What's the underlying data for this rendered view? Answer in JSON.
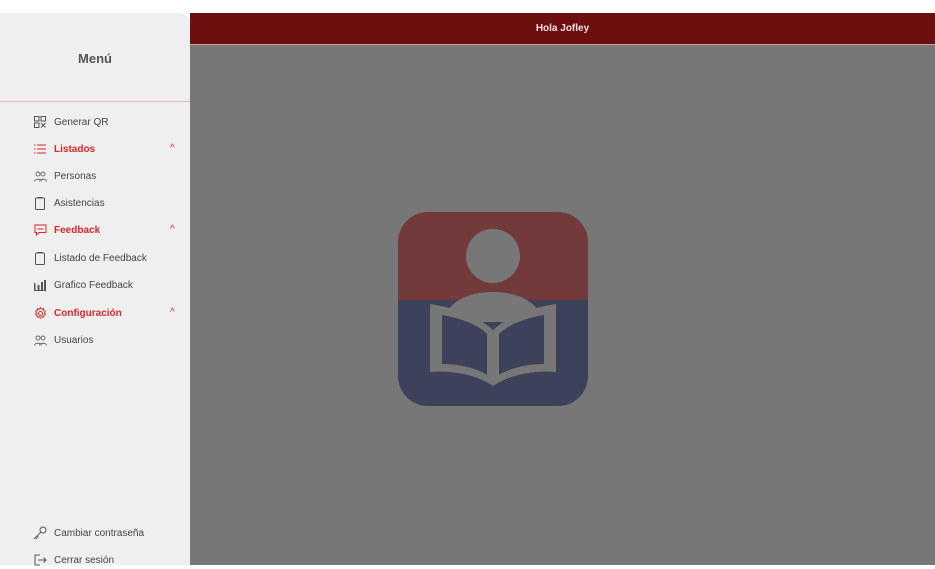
{
  "header": {
    "greeting": "Hola Jofley"
  },
  "sidebar": {
    "title": "Menú",
    "items": [
      {
        "label": "Generar QR",
        "icon": "qr-code-icon"
      },
      {
        "label": "Listados",
        "icon": "list-icon",
        "section": true,
        "expanded": true
      },
      {
        "label": "Personas",
        "icon": "people-icon"
      },
      {
        "label": "Asistencias",
        "icon": "clipboard-icon"
      },
      {
        "label": "Feedback",
        "icon": "chat-icon",
        "section": true,
        "expanded": true
      },
      {
        "label": "Listado de Feedback",
        "icon": "clipboard-icon"
      },
      {
        "label": "Grafico Feedback",
        "icon": "bar-chart-icon"
      },
      {
        "label": "Configuración",
        "icon": "gear-icon",
        "section": true,
        "expanded": true
      },
      {
        "label": "Usuarios",
        "icon": "people-icon"
      }
    ],
    "footer": [
      {
        "label": "Cambiar contraseña",
        "icon": "key-icon"
      },
      {
        "label": "Cerrar sesión",
        "icon": "logout-icon"
      }
    ],
    "chevron": "^"
  },
  "colors": {
    "topbar": "#6d0f0f",
    "accent": "#d2282b",
    "overlay": "#777777",
    "logo_top": "#733a3b",
    "logo_bottom": "#3d4159"
  }
}
